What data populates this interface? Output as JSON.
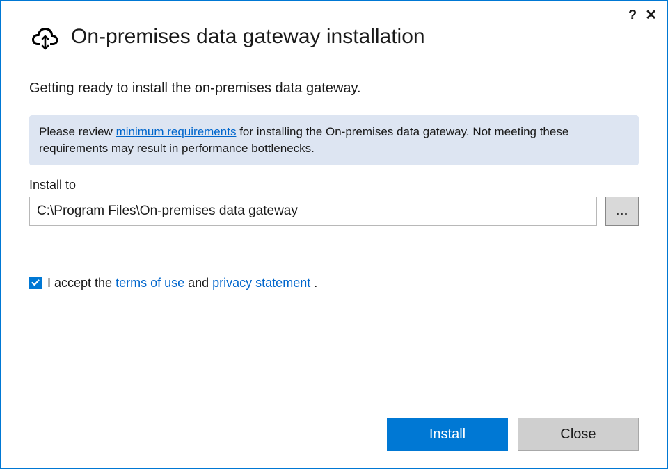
{
  "header": {
    "title": "On-premises data gateway installation"
  },
  "subtitle": "Getting ready to install the on-premises data gateway.",
  "info": {
    "prefix": "Please review ",
    "link": "minimum requirements",
    "suffix": " for installing the On-premises data gateway. Not meeting these requirements may result in performance bottlenecks."
  },
  "install": {
    "label": "Install to",
    "path": "C:\\Program Files\\On-premises data gateway",
    "browse_label": "..."
  },
  "accept": {
    "checked": true,
    "prefix": "I accept the ",
    "terms_link": "terms of use",
    "mid": " and ",
    "privacy_link": "privacy statement",
    "suffix": " ."
  },
  "buttons": {
    "install": "Install",
    "close": "Close"
  }
}
